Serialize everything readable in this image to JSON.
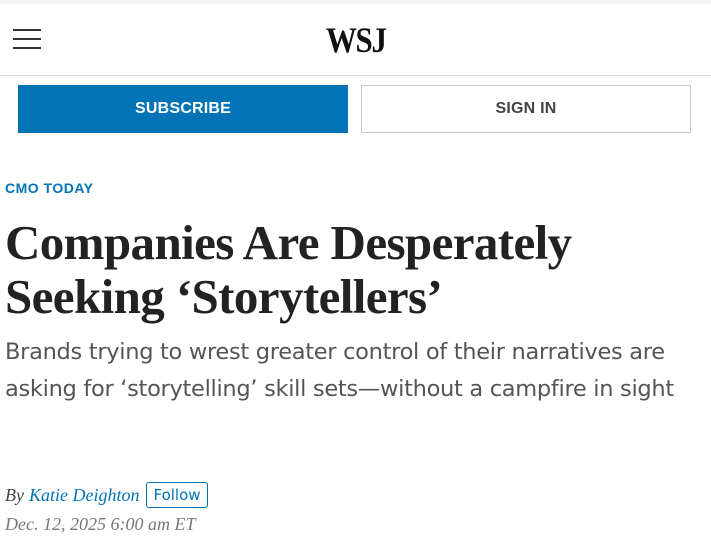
{
  "header": {
    "logo": "WSJ",
    "menu_icon": "hamburger-menu-icon"
  },
  "auth": {
    "subscribe_label": "SUBSCRIBE",
    "signin_label": "SIGN IN",
    "subscribe_color": "#0274b6"
  },
  "article": {
    "kicker": "CMO TODAY",
    "headline_line1": "Companies Are Desperately",
    "headline_line2": "Seeking ‘Storytellers’",
    "dek": "Brands trying to wrest greater control of their narratives are asking for ‘storytelling’ skill sets—without a campfire in sight",
    "byline_prefix": "By",
    "author": "Katie Deighton",
    "follow_label": "Follow",
    "timestamp": "Dec. 12, 2025 6:00 am ET"
  }
}
